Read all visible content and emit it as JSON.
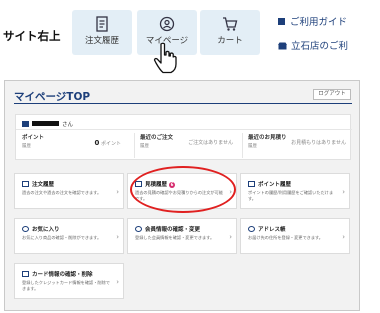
{
  "header": {
    "label": "サイト右上"
  },
  "tiles": [
    {
      "label": "注文履歴",
      "icon": "receipt-icon"
    },
    {
      "label": "マイページ",
      "icon": "user-circle-icon"
    },
    {
      "label": "カート",
      "icon": "cart-icon"
    }
  ],
  "links": [
    {
      "label": "ご利用ガイド"
    },
    {
      "label": "立石店のご利"
    }
  ],
  "panel": {
    "title": "マイページTOP",
    "logout": "ログアウト",
    "user_suffix": "さん",
    "summary": [
      {
        "label": "ポイント",
        "sub": "履歴",
        "value": "0",
        "unit": "ポイント"
      },
      {
        "label": "最近のご注文",
        "sub": "履歴",
        "value": "ご注文はありません"
      },
      {
        "label": "最近のお見積り",
        "sub": "履歴",
        "value": "お見積もりはありません"
      }
    ],
    "cards": [
      {
        "title": "注文履歴",
        "desc": "過去の注文や過去の注文を確認できます。"
      },
      {
        "title": "見積履歴",
        "badge": "6",
        "desc": "過去の見積の確認やお見積りからの注文が可能です。"
      },
      {
        "title": "ポイント履歴",
        "desc": "ポイントの履歴/利用履歴をご確認いただけます。"
      },
      {
        "title": "お気に入り",
        "desc": "お気に入り商品の確認・削除ができます。"
      },
      {
        "title": "会員情報の確認・変更",
        "desc": "登録した会員情報を確認・変更できます。"
      },
      {
        "title": "アドレス帳",
        "desc": "お届け先の住所を登録・変更できます。"
      },
      {
        "title": "カード情報の確認・削除",
        "desc": "登録したクレジットカード情報を確認・削除できます。"
      }
    ]
  },
  "colors": {
    "accent": "#1d3f7a",
    "tile_bg": "#e3eef6",
    "highlight": "#e02020",
    "badge": "#d62a6c"
  }
}
